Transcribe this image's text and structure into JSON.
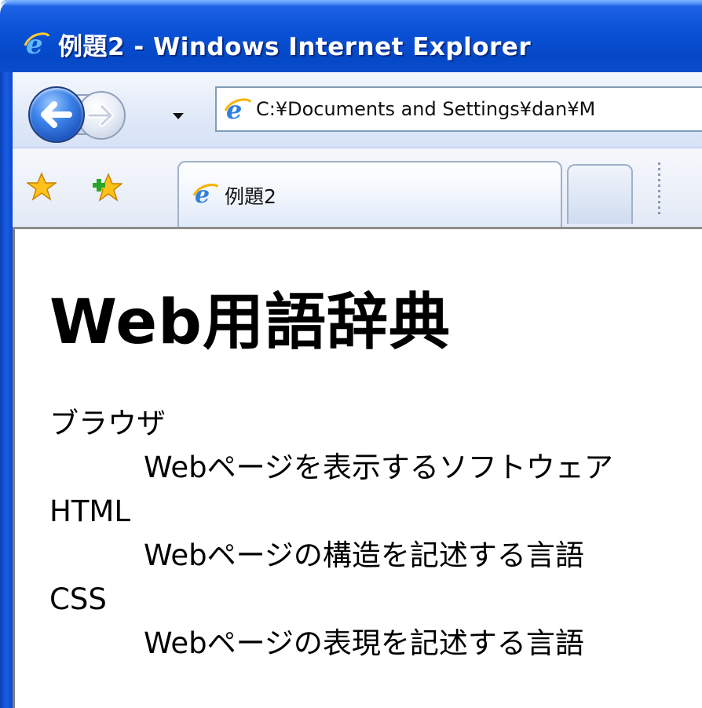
{
  "window": {
    "title": "例題2 - Windows Internet Explorer"
  },
  "navbar": {
    "address": "C:¥Documents and Settings¥dan¥M"
  },
  "tabs": [
    {
      "label": "例題2",
      "active": true
    }
  ],
  "page": {
    "heading": "Web用語辞典",
    "definitions": [
      {
        "term": "ブラウザ",
        "description": "Webページを表示するソフトウェア"
      },
      {
        "term": "HTML",
        "description": "Webページの構造を記述する言語"
      },
      {
        "term": "CSS",
        "description": "Webページの表現を記述する言語"
      }
    ]
  },
  "colors": {
    "titlebar": "#0548c6",
    "title_text": "#ffffff"
  },
  "icons": {
    "title": "ie-logo-icon",
    "back": "back-arrow-icon",
    "forward": "forward-arrow-icon",
    "favorites": "favorites-star-icon",
    "add_favorite": "add-favorite-icon"
  }
}
